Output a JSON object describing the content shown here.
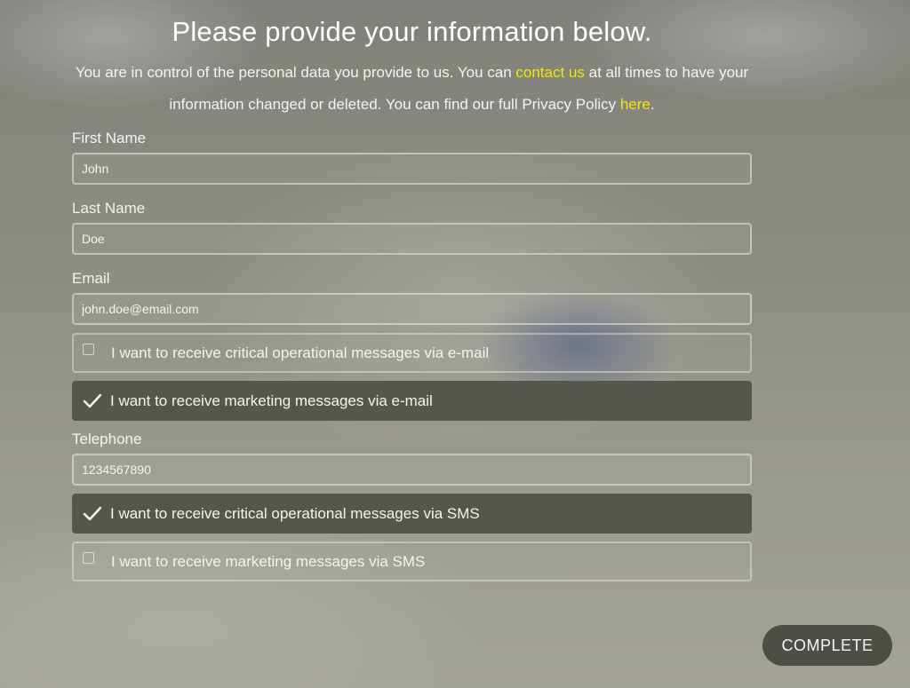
{
  "header": {
    "title": "Please provide your information below.",
    "intro_part1": "You are in control of the personal data you provide to us. You can ",
    "contact_link": "contact us",
    "intro_part2": " at all times to have your information changed or deleted. You can find our full Privacy Policy ",
    "privacy_link": "here",
    "intro_end": "."
  },
  "form": {
    "first_name": {
      "label": "First Name",
      "value": "John"
    },
    "last_name": {
      "label": "Last Name",
      "value": "Doe"
    },
    "email": {
      "label": "Email",
      "value": "john.doe@email.com"
    },
    "email_options": [
      {
        "label": "I want to receive critical operational messages via e-mail",
        "checked": false
      },
      {
        "label": "I want to receive marketing messages via e-mail",
        "checked": true
      }
    ],
    "telephone": {
      "label": "Telephone",
      "value": "1234567890"
    },
    "sms_options": [
      {
        "label": "I want to receive critical operational messages via SMS",
        "checked": true
      },
      {
        "label": "I want to receive marketing messages via SMS",
        "checked": false
      }
    ]
  },
  "actions": {
    "complete_label": "COMPLETE"
  },
  "colors": {
    "link": "#f2e600",
    "checked_row": "#56574c",
    "button": "#4d4e45"
  },
  "icons": {
    "checked": "checkmark-icon",
    "unchecked": "empty-checkbox-icon"
  }
}
